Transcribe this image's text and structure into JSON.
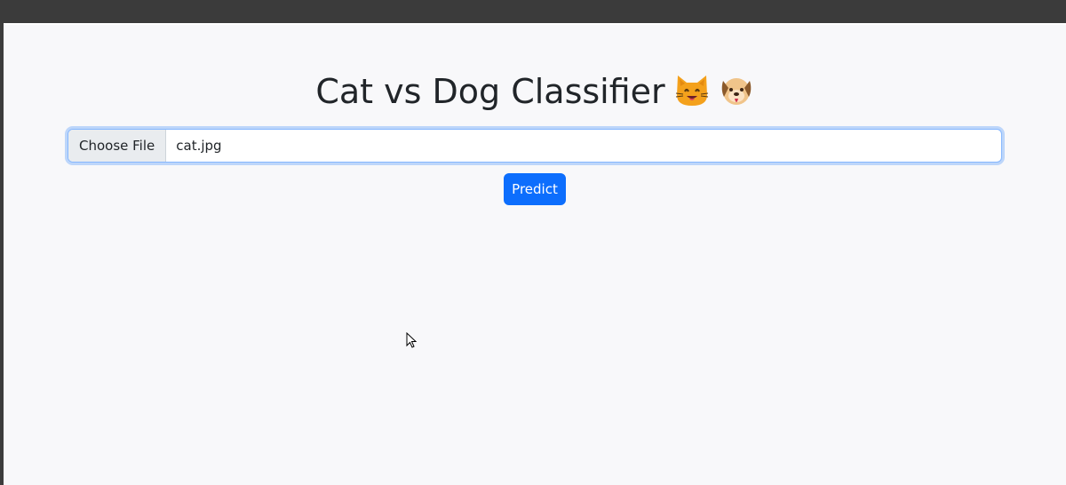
{
  "page": {
    "title": "Cat vs Dog Classifier",
    "title_icons": [
      "cat-face-icon",
      "dog-face-icon"
    ]
  },
  "upload": {
    "choose_label": "Choose File",
    "file_name": "cat.jpg"
  },
  "actions": {
    "predict_label": "Predict"
  },
  "colors": {
    "primary": "#0d6efd",
    "background": "#f8f8fa",
    "text": "#212529"
  }
}
